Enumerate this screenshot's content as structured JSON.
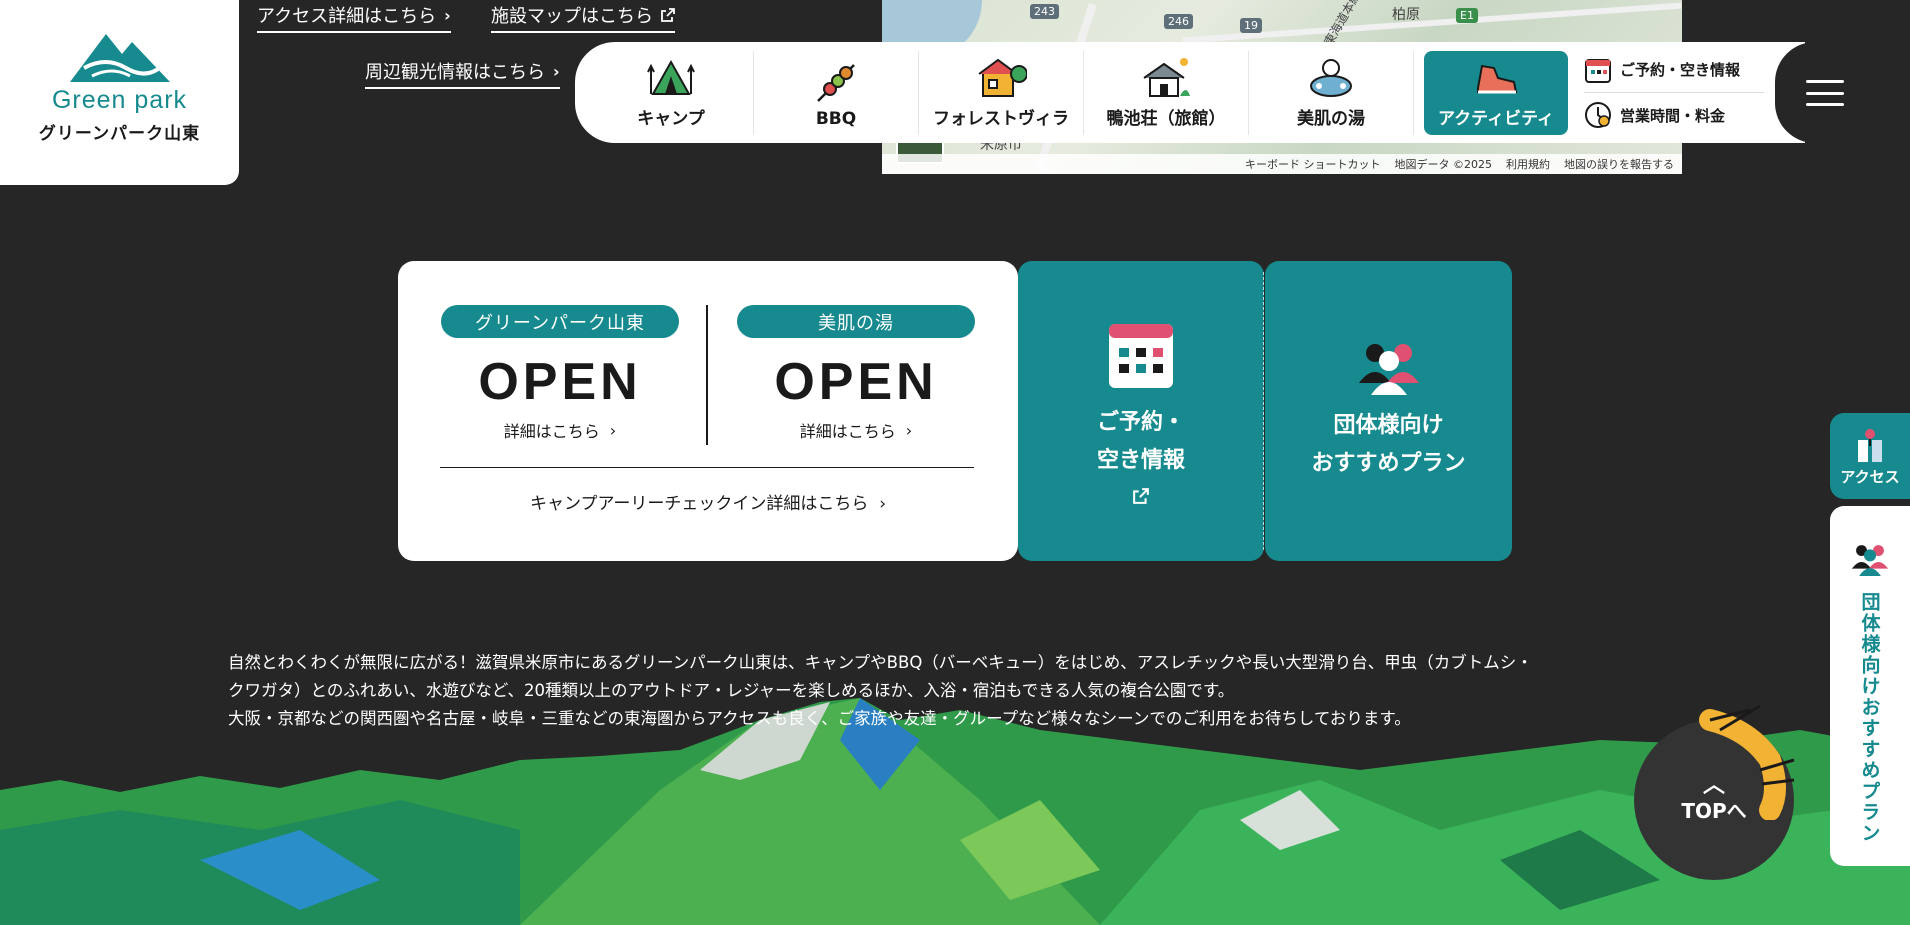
{
  "logo": {
    "en": "Green park",
    "jp": "グリーンパーク山東"
  },
  "top_links": {
    "access": "アクセス詳細はこちら",
    "facility_map": "施設マップはこちら",
    "sightseeing": "周辺観光情報はこちら"
  },
  "map": {
    "shields": [
      "243",
      "246",
      "19",
      "E1"
    ],
    "places": [
      "柏原",
      "米原市",
      "東海道本線"
    ],
    "footer": [
      "キーボード ショートカット",
      "地図データ ©2025",
      "利用規約",
      "地図の誤りを報告する"
    ]
  },
  "nav": {
    "items": [
      {
        "label": "キャンプ",
        "icon": "camp-tent-icon"
      },
      {
        "label": "BBQ",
        "icon": "bbq-skewer-icon"
      },
      {
        "label": "フォレストヴィラ",
        "icon": "forest-villa-icon"
      },
      {
        "label": "鴨池荘（旅館）",
        "icon": "ryokan-icon"
      },
      {
        "label": "美肌の湯",
        "icon": "hot-spring-icon"
      },
      {
        "label": "アクティビティ",
        "icon": "shoe-icon"
      }
    ],
    "side": {
      "reserve": "ご予約・空き情報",
      "hours": "営業時間・料金"
    },
    "accent": "#168a8e"
  },
  "status": {
    "park": {
      "name": "グリーンパーク山東",
      "state": "OPEN",
      "detail": "詳細はこちら"
    },
    "onsen": {
      "name": "美肌の湯",
      "state": "OPEN",
      "detail": "詳細はこちら"
    },
    "early_checkin": "キャンプアーリーチェックイン詳細はこちら"
  },
  "cards": {
    "reserve_line1": "ご予約・",
    "reserve_line2": "空き情報",
    "group_line1": "団体様向け",
    "group_line2": "おすすめプラン"
  },
  "description": {
    "line1": "自然とわくわくが無限に広がる！滋賀県米原市にあるグリーンパーク山東は、キャンプやBBQ（バーベキュー）をはじめ、アスレチックや長い大型滑り台、甲虫（カブトムシ・",
    "line2": "クワガタ）とのふれあい、水遊びなど、20種類以上のアウトドア・レジャーを楽しめるほか、入浴・宿泊もできる人気の複合公園です。",
    "line3": "大阪・京都などの関西圏や名古屋・岐阜・三重などの東海圏からアクセスも良く、ご家族や友達・グループなど様々なシーンでのご利用をお待ちしております。"
  },
  "floating": {
    "access": "アクセス",
    "group": "団体様向けおすすめプラン"
  },
  "top_button": "TOPへ"
}
